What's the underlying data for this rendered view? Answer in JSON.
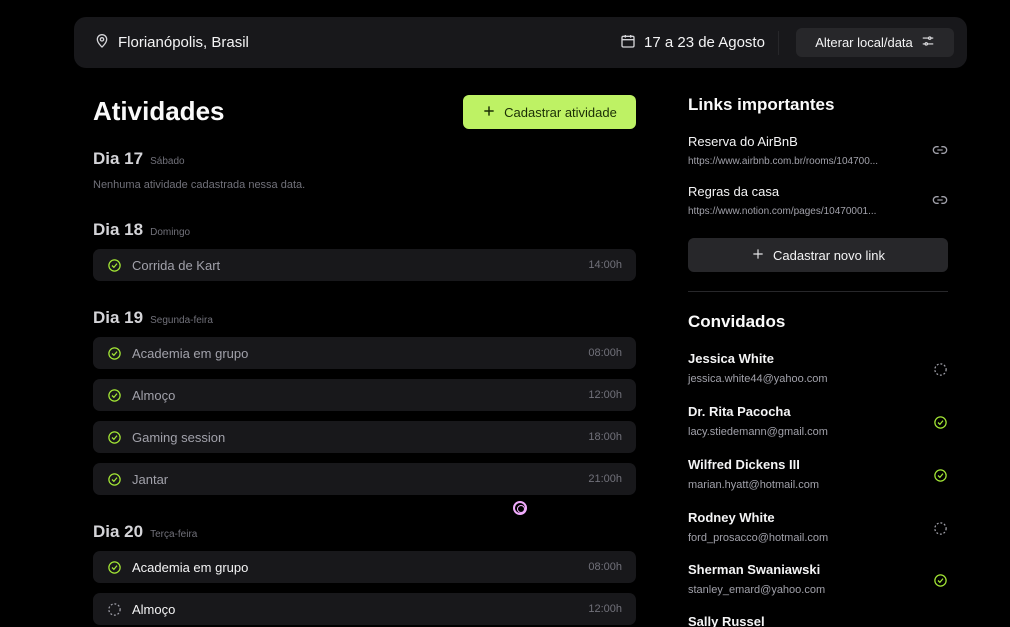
{
  "header": {
    "location_icon": "map-pin-icon",
    "location": "Florianópolis, Brasil",
    "calendar_icon": "calendar-icon",
    "date_range": "17 a 23 de Agosto",
    "change_button": "Alterar local/data",
    "change_icon": "settings-sliders-icon"
  },
  "activities": {
    "title": "Atividades",
    "add_button": "Cadastrar atividade",
    "empty_text": "Nenhuma atividade cadastrada nessa data.",
    "days": [
      {
        "label": "Dia 17",
        "weekday": "Sábado"
      },
      {
        "label": "Dia 18",
        "weekday": "Domingo",
        "items": [
          {
            "name": "Corrida de Kart",
            "time": "14:00h",
            "status": "done"
          }
        ]
      },
      {
        "label": "Dia 19",
        "weekday": "Segunda-feira",
        "items": [
          {
            "name": "Academia em grupo",
            "time": "08:00h",
            "status": "done"
          },
          {
            "name": "Almoço",
            "time": "12:00h",
            "status": "done"
          },
          {
            "name": "Gaming session",
            "time": "18:00h",
            "status": "done"
          },
          {
            "name": "Jantar",
            "time": "21:00h",
            "status": "done"
          }
        ]
      },
      {
        "label": "Dia 20",
        "weekday": "Terça-feira",
        "items": [
          {
            "name": "Academia em grupo",
            "time": "08:00h",
            "status": "done"
          },
          {
            "name": "Almoço",
            "time": "12:00h",
            "status": "pending"
          }
        ]
      }
    ]
  },
  "links": {
    "title": "Links importantes",
    "items": [
      {
        "name": "Reserva do AirBnB",
        "url": "https://www.airbnb.com.br/rooms/104700..."
      },
      {
        "name": "Regras da casa",
        "url": "https://www.notion.com/pages/10470001..."
      }
    ],
    "add_button": "Cadastrar novo link"
  },
  "guests": {
    "title": "Convidados",
    "items": [
      {
        "name": "Jessica White",
        "email": "jessica.white44@yahoo.com",
        "status": "pending"
      },
      {
        "name": "Dr. Rita Pacocha",
        "email": "lacy.stiedemann@gmail.com",
        "status": "confirmed"
      },
      {
        "name": "Wilfred Dickens III",
        "email": "marian.hyatt@hotmail.com",
        "status": "confirmed"
      },
      {
        "name": "Rodney White",
        "email": "ford_prosacco@hotmail.com",
        "status": "pending"
      },
      {
        "name": "Sherman Swaniawski",
        "email": "stanley_emard@yahoo.com",
        "status": "confirmed"
      },
      {
        "name": "Sally Russel",
        "email": "",
        "status": "pending"
      }
    ]
  },
  "colors": {
    "accent": "#bef264",
    "check": "#a3e635"
  }
}
